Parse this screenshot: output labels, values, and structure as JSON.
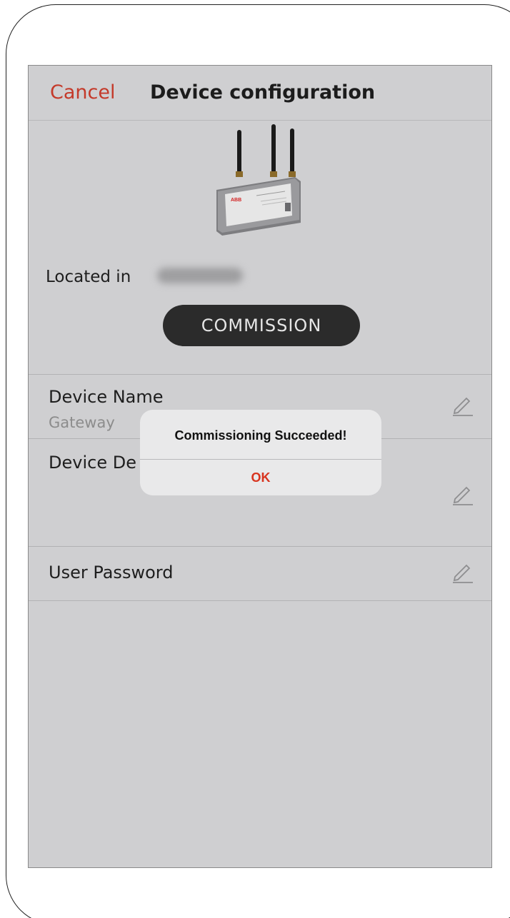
{
  "nav": {
    "cancel_label": "Cancel",
    "title": "Device configuration"
  },
  "device": {
    "image_icon": "gateway-device-image",
    "brand_label": "ABB",
    "located_label": "Located in",
    "commission_label": "COMMISSION"
  },
  "fields": {
    "device_name": {
      "label": "Device Name",
      "value": "Gateway"
    },
    "device_description": {
      "label": "Device De"
    },
    "user_password": {
      "label": "User Password"
    }
  },
  "alert": {
    "title": "Commissioning Succeeded!",
    "ok_label": "OK"
  },
  "colors": {
    "accent_red": "#c43a2a",
    "alert_ok": "#d8341f",
    "screen_bg": "#cfcfd1",
    "button_dark": "#2b2b2b"
  }
}
